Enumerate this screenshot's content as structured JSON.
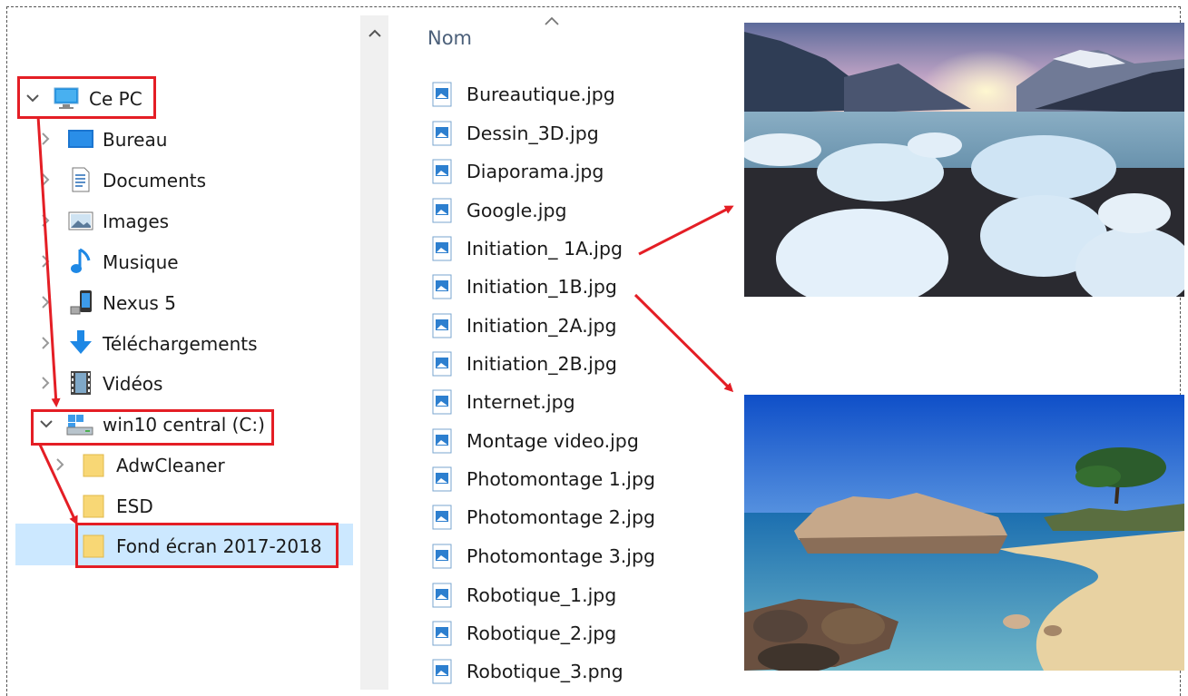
{
  "nav": {
    "this_pc": "Ce PC",
    "bureau": "Bureau",
    "documents": "Documents",
    "images": "Images",
    "musique": "Musique",
    "nexus": "Nexus 5",
    "telechargements": "Téléchargements",
    "videos": "Vidéos",
    "drive": "win10 central (C:)",
    "adwcleaner": "AdwCleaner",
    "esd": "ESD",
    "fond": "Fond écran 2017-2018"
  },
  "list": {
    "column": "Nom",
    "files": [
      "Bureautique.jpg",
      "Dessin_3D.jpg",
      "Diaporama.jpg",
      "Google.jpg",
      "Initiation_ 1A.jpg",
      "Initiation_1B.jpg",
      "Initiation_2A.jpg",
      "Initiation_2B.jpg",
      "Internet.jpg",
      "Montage video.jpg",
      "Photomontage 1.jpg",
      "Photomontage 2.jpg",
      "Photomontage 3.jpg",
      "Robotique_1.jpg",
      "Robotique_2.jpg",
      "Robotique_3.png"
    ]
  },
  "colors": {
    "highlight": "#e41e25",
    "selection": "#cce8ff",
    "folder": "#f8d775",
    "header_text": "#4c607a"
  }
}
